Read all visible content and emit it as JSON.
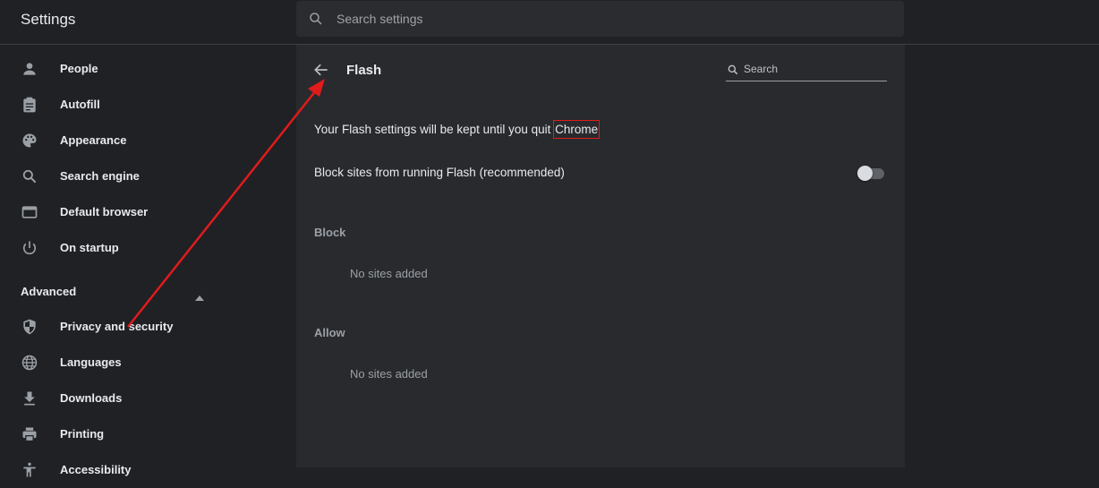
{
  "header": {
    "title": "Settings",
    "search_placeholder": "Search settings"
  },
  "sidebar": {
    "items": [
      {
        "label": "People",
        "icon": "person-icon"
      },
      {
        "label": "Autofill",
        "icon": "clipboard-icon"
      },
      {
        "label": "Appearance",
        "icon": "palette-icon"
      },
      {
        "label": "Search engine",
        "icon": "search-icon"
      },
      {
        "label": "Default browser",
        "icon": "browser-icon"
      },
      {
        "label": "On startup",
        "icon": "power-icon"
      }
    ],
    "advanced_label": "Advanced",
    "advanced_items": [
      {
        "label": "Privacy and security",
        "icon": "shield-icon"
      },
      {
        "label": "Languages",
        "icon": "globe-icon"
      },
      {
        "label": "Downloads",
        "icon": "download-icon"
      },
      {
        "label": "Printing",
        "icon": "printer-icon"
      },
      {
        "label": "Accessibility",
        "icon": "accessibility-icon"
      }
    ]
  },
  "page": {
    "title": "Flash",
    "search_placeholder": "Search",
    "notice_prefix": "Your Flash settings will be kept until you quit ",
    "notice_highlight": "Chrome",
    "block_toggle_label": "Block sites from running Flash (recommended)",
    "block_toggle_on": false,
    "block_heading": "Block",
    "block_empty": "No sites added",
    "allow_heading": "Allow",
    "allow_empty": "No sites added"
  },
  "colors": {
    "background": "#202124",
    "card": "#292a2d",
    "annotation": "#e01b1b"
  }
}
